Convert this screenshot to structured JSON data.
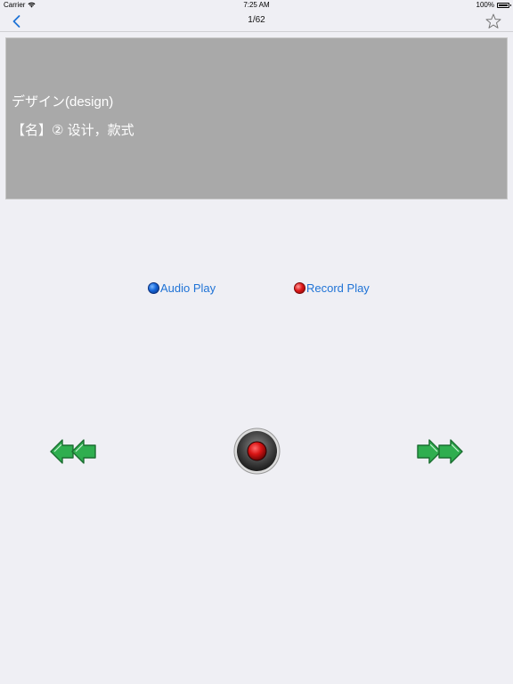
{
  "status_bar": {
    "carrier": "Carrier",
    "time": "7:25 AM",
    "battery": "100%"
  },
  "nav_bar": {
    "title": "1/62",
    "back_icon": "chevron-left-icon",
    "favorite_icon": "star-outline-icon"
  },
  "card": {
    "term": "デザイン(design)",
    "meaning": "【名】② 设计，款式"
  },
  "controls": {
    "audio_play_label": "Audio Play",
    "record_play_label": "Record Play",
    "prev_icon": "double-left-arrow-icon",
    "next_icon": "double-right-arrow-icon",
    "record_icon": "record-icon"
  },
  "colors": {
    "accent_blue": "#1f73d6",
    "card_gray": "#a9a9a9",
    "arrow_green": "#2fae4f",
    "record_red": "#d81414",
    "background": "#efeff4"
  }
}
